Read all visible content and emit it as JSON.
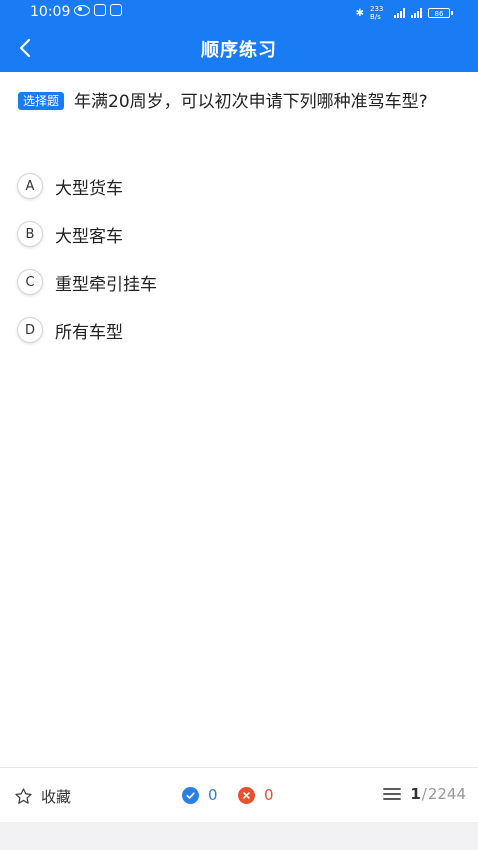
{
  "status_bar": {
    "time": "10:09",
    "network_speed": "233 B/s",
    "battery": "86"
  },
  "header": {
    "title": "顺序练习"
  },
  "question": {
    "type_badge": "选择题",
    "text": "年满20周岁，可以初次申请下列哪种准驾车型?"
  },
  "options": [
    {
      "letter": "A",
      "text": "大型货车"
    },
    {
      "letter": "B",
      "text": "大型客车"
    },
    {
      "letter": "C",
      "text": "重型牵引挂车"
    },
    {
      "letter": "D",
      "text": "所有车型"
    }
  ],
  "bottom_bar": {
    "favorite_label": "收藏",
    "correct_count": "0",
    "wrong_count": "0",
    "current_index": "1",
    "separator": "/",
    "total": "2244"
  },
  "colors": {
    "primary": "#1a7cf5",
    "correct": "#2b7fe0",
    "wrong": "#e8502e"
  }
}
